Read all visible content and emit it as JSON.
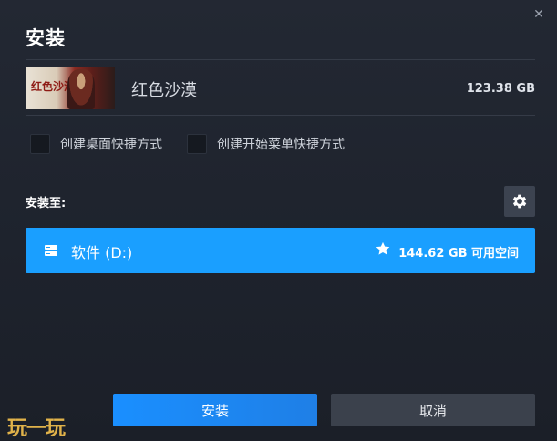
{
  "dialog": {
    "title": "安装",
    "close_glyph": "✕"
  },
  "game": {
    "thumbnail_text": "红色沙漠",
    "name": "红色沙漠",
    "size": "123.38 GB"
  },
  "options": {
    "desktop_shortcut_label": "创建桌面快捷方式",
    "start_menu_shortcut_label": "创建开始菜单快捷方式"
  },
  "install_location": {
    "label": "安装至:",
    "drive_name": "软件 (D:)",
    "free_space": "144.62 GB 可用空间",
    "drive_icon": "drive-icon",
    "favorite_icon": "star-icon",
    "settings_icon": "gear-icon"
  },
  "actions": {
    "install_label": "安装",
    "cancel_label": "取消"
  },
  "watermark": {
    "text": "玩一玩"
  },
  "colors": {
    "accent": "#1a9fff",
    "background": "#1e232d",
    "secondary_button": "#3b414c"
  }
}
